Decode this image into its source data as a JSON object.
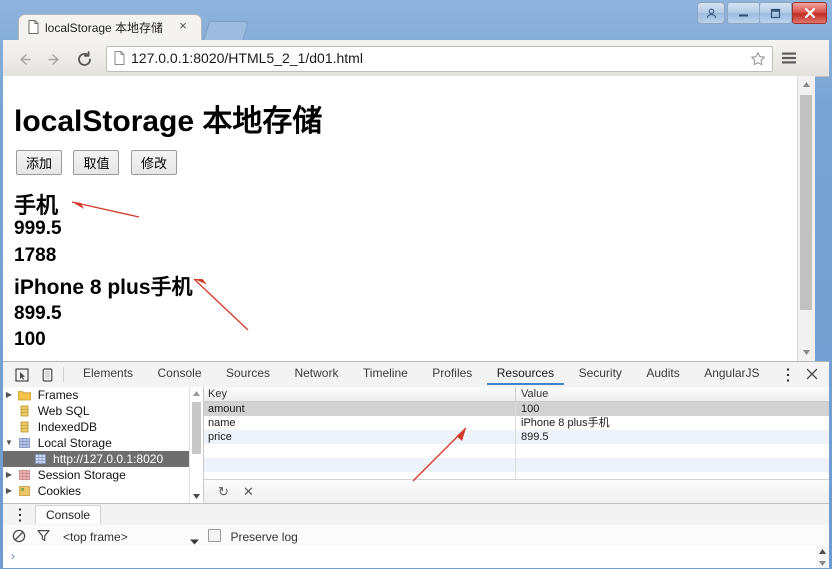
{
  "window": {
    "buttons": {
      "user": "user-account",
      "minimize": "minimize",
      "maximize": "maximize",
      "close": "close"
    }
  },
  "browser": {
    "tab": {
      "title": "localStorage 本地存储",
      "close_label": "×"
    },
    "new_tab_label": "",
    "nav": {
      "back": "back",
      "forward": "forward",
      "reload": "reload"
    },
    "omnibox": {
      "url": "127.0.0.1:8020/HTML5_2_1/d01.html",
      "bookmark": "star-icon",
      "menu": "menu-icon"
    }
  },
  "page": {
    "title": "localStorage 本地存储",
    "buttons": [
      {
        "label": "添加"
      },
      {
        "label": "取值"
      },
      {
        "label": "修改"
      }
    ],
    "output_lines": [
      "手机",
      "999.5",
      "1788",
      "iPhone 8 plus手机",
      "899.5",
      "100"
    ]
  },
  "devtools": {
    "tabs": [
      {
        "label": "Elements",
        "active": false
      },
      {
        "label": "Console",
        "active": false
      },
      {
        "label": "Sources",
        "active": false
      },
      {
        "label": "Network",
        "active": false
      },
      {
        "label": "Timeline",
        "active": false
      },
      {
        "label": "Profiles",
        "active": false
      },
      {
        "label": "Resources",
        "active": true
      },
      {
        "label": "Security",
        "active": false
      },
      {
        "label": "Audits",
        "active": false
      },
      {
        "label": "AngularJS",
        "active": false
      }
    ],
    "accent_color": "#4285cf",
    "more_label": "⋮",
    "close_label": "×",
    "tree": [
      {
        "label": "Frames",
        "icon": "folder-icon",
        "twisty": "▶",
        "selected": false,
        "indent": 0
      },
      {
        "label": "Web SQL",
        "icon": "database-icon",
        "twisty": "",
        "selected": false,
        "indent": 0
      },
      {
        "label": "IndexedDB",
        "icon": "database-icon",
        "twisty": "",
        "selected": false,
        "indent": 0
      },
      {
        "label": "Local Storage",
        "icon": "storage-icon",
        "twisty": "▼",
        "selected": false,
        "indent": 0
      },
      {
        "label": "http://127.0.0.1:8020",
        "icon": "storage-icon",
        "twisty": "",
        "selected": true,
        "indent": 1
      },
      {
        "label": "Session Storage",
        "icon": "session-icon",
        "twisty": "▶",
        "selected": false,
        "indent": 0
      },
      {
        "label": "Cookies",
        "icon": "cookie-icon",
        "twisty": "▶",
        "selected": false,
        "indent": 0
      }
    ],
    "table": {
      "columns": [
        "Key",
        "Value"
      ],
      "rows": [
        {
          "key": "amount",
          "value": "100",
          "selected": true
        },
        {
          "key": "name",
          "value": "iPhone 8 plus手机",
          "selected": false
        },
        {
          "key": "price",
          "value": "899.5",
          "selected": false
        }
      ]
    },
    "table_toolbar": {
      "refresh": "↻",
      "delete": "✕"
    },
    "drawer": {
      "dots_label": "⋮",
      "tab_label": "Console",
      "clear_icon": "clear-console-icon",
      "filter_icon": "filter-icon",
      "frame_selector": "<top frame>",
      "frame_caret": "▾",
      "preserve_log_label": "Preserve log",
      "preserve_log_checked": false,
      "prompt": "›"
    }
  },
  "annotations": {
    "arrow_color": "#d43a2a",
    "count": 3
  }
}
